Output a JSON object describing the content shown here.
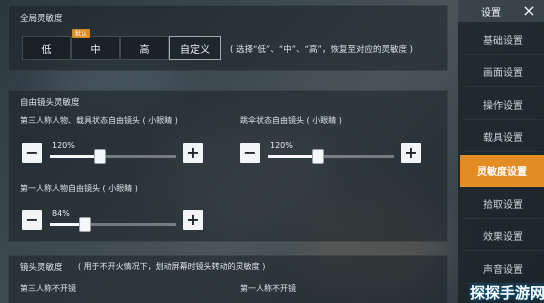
{
  "global_sensitivity": {
    "title": "全局灵敏度",
    "options": [
      "低",
      "中",
      "高",
      "自定义"
    ],
    "badge": "默认",
    "hint": "( 选择“低”、“中”、“高”，恢复至对应的灵敏度 )"
  },
  "free_camera": {
    "title": "自由镜头灵敏度",
    "sliders": [
      {
        "label": "第三人称人物、载具状态自由镜头 ( 小眼睛 )",
        "value_text": "120%",
        "value": 1.2
      },
      {
        "label": "跳伞状态自由镜头 ( 小眼睛 )",
        "value_text": "120%",
        "value": 1.2
      },
      {
        "label": "第一人称人物自由镜头 ( 小眼睛 )",
        "value_text": "84%",
        "value": 0.84
      }
    ]
  },
  "lens_sensitivity": {
    "title": "镜头灵敏度",
    "hint": "( 用于不开火情况下，划动屏幕时镜头转动的灵敏度 )",
    "items": [
      "第三人称不开镜",
      "第一人称不开镜"
    ]
  },
  "sidebar": {
    "title": "设置",
    "items": [
      "基础设置",
      "画面设置",
      "操作设置",
      "载具设置",
      "灵敏度设置",
      "拾取设置",
      "效果设置",
      "声音设置"
    ],
    "active_index": 4
  },
  "watermark": "探探手游网",
  "icons": {
    "minus": "−",
    "plus": "+",
    "close": "×"
  }
}
